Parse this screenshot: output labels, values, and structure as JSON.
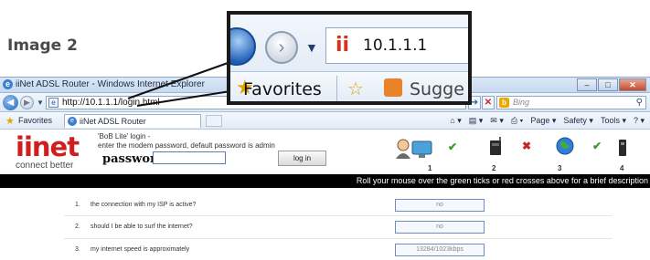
{
  "caption": "Image 2",
  "window": {
    "title": "iiNet ADSL Router - Windows Internet Explorer",
    "url": "http://10.1.1.1/login.html",
    "search_placeholder": "Bing",
    "favorites_label": "Favorites",
    "tab_label": "iiNet ADSL Router",
    "tools": [
      "Page ▾",
      "Safety ▾",
      "Tools ▾"
    ]
  },
  "page": {
    "logo_text": "iinet",
    "logo_sub": "connect better",
    "login_heading_line1": "'BoB Lite' login -",
    "login_heading_line2": "enter the modem password, default password is admin",
    "password_label": "password:",
    "password_value": "",
    "login_button": "log in",
    "status_numbers": [
      "1",
      "2",
      "3",
      "4"
    ],
    "hint": "Roll your mouse over the green ticks or red crosses above for a brief description",
    "questions": [
      {
        "num": "1.",
        "text": "the connection with my ISP is active?",
        "value": "no"
      },
      {
        "num": "2.",
        "text": "should I be able to surf the internet?",
        "value": "no"
      },
      {
        "num": "3.",
        "text": "my internet speed is approximately",
        "value": "13284/1023kbps"
      }
    ]
  },
  "magnifier": {
    "url": "10.1.1.1",
    "favorites_label": "Favorites",
    "suggested_label": "Sugge"
  },
  "colors": {
    "brand_red": "#d01d1d",
    "tick_green": "#3a9b2a",
    "cross_red": "#c1272d"
  }
}
